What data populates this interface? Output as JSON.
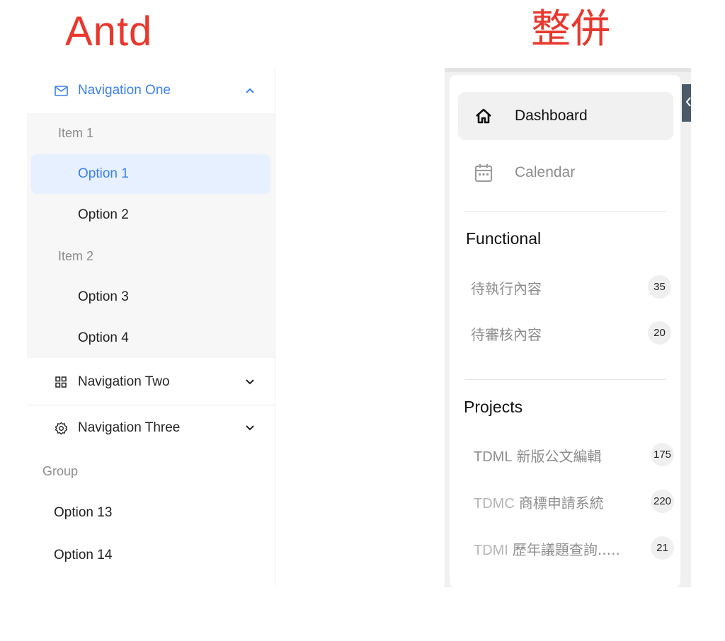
{
  "headings": {
    "left": "Antd",
    "right": "整併"
  },
  "antd_menu": {
    "nav_one": {
      "label": "Navigation One",
      "icon": "mail-icon"
    },
    "item_1": "Item 1",
    "option_1": "Option 1",
    "option_2": "Option 2",
    "item_2": "Item 2",
    "option_3": "Option 3",
    "option_4": "Option 4",
    "nav_two": {
      "label": "Navigation Two",
      "icon": "appstore-icon"
    },
    "nav_three": {
      "label": "Navigation Three",
      "icon": "setting-icon"
    },
    "group": "Group",
    "option_13": "Option 13",
    "option_14": "Option 14",
    "accent_color": "#3b7ff0"
  },
  "sidebar": {
    "dashboard": {
      "label": "Dashboard",
      "icon": "home-icon"
    },
    "calendar": {
      "label": "Calendar",
      "icon": "calendar-icon"
    },
    "functional": {
      "title": "Functional",
      "items": [
        {
          "label": "待執行內容",
          "count": "35"
        },
        {
          "label": "待審核內容",
          "count": "20"
        }
      ]
    },
    "projects": {
      "title": "Projects",
      "items": [
        {
          "code": "TDML",
          "name": "新版公文編輯",
          "count": "175"
        },
        {
          "code": "TDMC",
          "name": "商標申請系統",
          "count": "220"
        },
        {
          "code": "TDMI",
          "name": "歷年議題查詢.....",
          "count": "21"
        }
      ]
    }
  }
}
